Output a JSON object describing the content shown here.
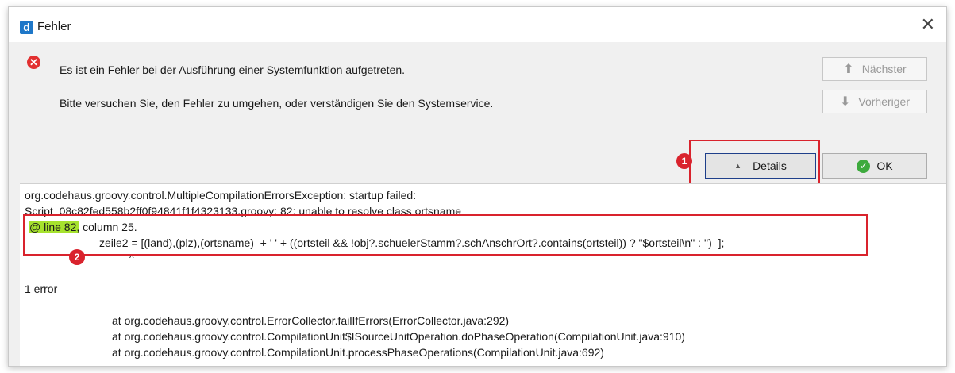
{
  "window": {
    "title": "Fehler",
    "app_icon_letter": "d",
    "close_glyph": "✕"
  },
  "message": {
    "line1": "Es ist ein Fehler bei der Ausführung einer Systemfunktion aufgetreten.",
    "line2": "Bitte versuchen Sie, den Fehler zu umgehen, oder verständigen Sie den Systemservice."
  },
  "buttons": {
    "next_label": "Nächster",
    "prev_label": "Vorheriger",
    "details_label": "Details",
    "ok_label": "OK"
  },
  "annotations": {
    "marker1": "1",
    "marker2": "2",
    "color": "#d9232d"
  },
  "details": {
    "line1": "org.codehaus.groovy.control.MultipleCompilationErrorsException: startup failed:",
    "line2": "Script_08c82fed558b2ff0f94841f1f4323133.groovy: 82: unable to resolve class ortsname",
    "line3_highlight": "@ line 82,",
    "line3_rest": " column 25.",
    "line4": "zeile2 = [(land),(plz),(ortsname)  + ' ' + ((ortsteil && !obj?.schuelerStamm?.schAnschrOrt?.contains(ortsteil)) ? \"$ortsteil\\n\" : '')  ];",
    "caret": "^",
    "line5": "1 error",
    "stack": [
      "at org.codehaus.groovy.control.ErrorCollector.failIfErrors(ErrorCollector.java:292)",
      "at org.codehaus.groovy.control.CompilationUnit$ISourceUnitOperation.doPhaseOperation(CompilationUnit.java:910)",
      "at org.codehaus.groovy.control.CompilationUnit.processPhaseOperations(CompilationUnit.java:692)"
    ],
    "highlight_color": "#a6e22e"
  }
}
